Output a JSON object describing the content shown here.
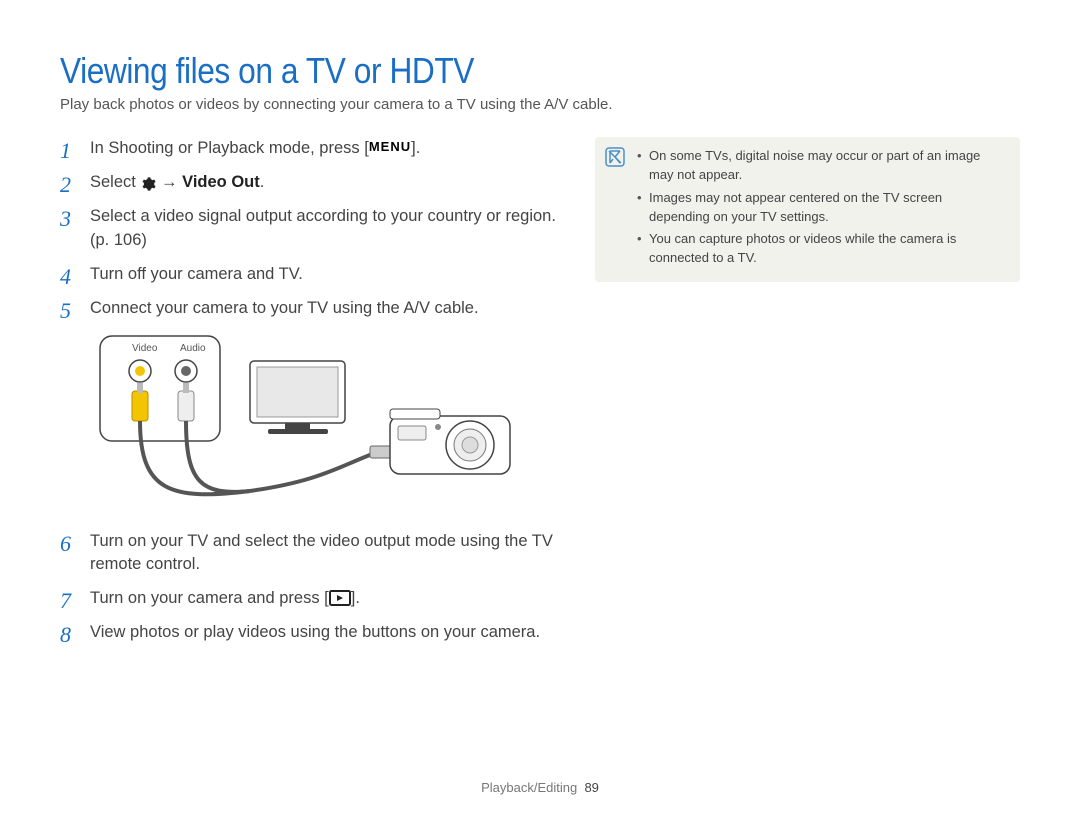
{
  "title": "Viewing files on a TV or HDTV",
  "subtitle": "Play back photos or videos by connecting your camera to a TV using the A/V cable.",
  "steps": {
    "s1_a": "In Shooting or Playback mode, press [",
    "s1_b": "].",
    "s2_a": "Select ",
    "s2_arrow": " → ",
    "s2_b": "Video Out",
    "s2_c": ".",
    "s3": "Select a video signal output according to your country or region. (p. 106)",
    "s4": "Turn off your camera and TV.",
    "s5": "Connect your camera to your TV using the A/V cable.",
    "s6": "Turn on your TV and select the video output mode using the TV remote control.",
    "s7_a": "Turn on your camera and press [",
    "s7_b": "].",
    "s8": "View photos or play videos using the buttons on your camera."
  },
  "nums": {
    "n1": "1",
    "n2": "2",
    "n3": "3",
    "n4": "4",
    "n5": "5",
    "n6": "6",
    "n7": "7",
    "n8": "8"
  },
  "diagram_labels": {
    "video": "Video",
    "audio": "Audio"
  },
  "icons": {
    "menu": "MENU"
  },
  "notes": {
    "n1": "On some TVs, digital noise may occur or part of an image may not appear.",
    "n2": "Images may not appear centered on the TV screen depending on your TV settings.",
    "n3": "You can capture photos or videos while the camera is connected to a TV."
  },
  "footer": {
    "section": "Playback/Editing",
    "page": "89"
  }
}
